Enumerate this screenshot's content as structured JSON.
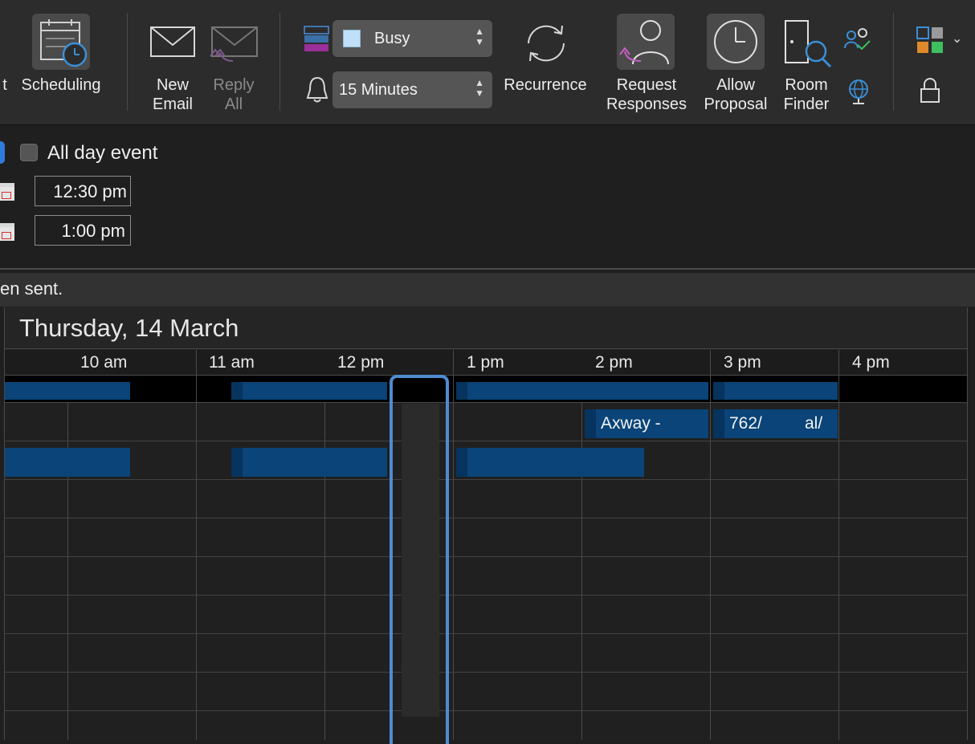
{
  "ribbon": {
    "scheduling_label": "Scheduling",
    "scheduling_prefix": "t",
    "new_email_label_1": "New",
    "new_email_label_2": "Email",
    "reply_all_label_1": "Reply",
    "reply_all_label_2": "All",
    "show_as_value": "Busy",
    "reminder_value": "15 Minutes",
    "recurrence_label": "Recurrence",
    "request_responses_label_1": "Request",
    "request_responses_label_2": "Responses",
    "allow_proposal_label_1": "Allow",
    "allow_proposal_label_2": "Proposal",
    "room_finder_label_1": "Room",
    "room_finder_label_2": "Finder"
  },
  "form": {
    "all_day_label": "All day event",
    "start_time": "12:30 pm",
    "end_time": "1:00 pm"
  },
  "infobar": {
    "text": "en sent."
  },
  "schedule": {
    "date": "Thursday, 14 March",
    "hours": [
      "10 am",
      "11 am",
      "12 pm",
      "1 pm",
      "2 pm",
      "3 pm",
      "4 pm"
    ],
    "events": [
      "Axway -",
      "762/",
      "al/"
    ]
  },
  "colors": {
    "busy_block": "#0a4478",
    "selection_border": "#4f8bd0",
    "background": "#1f1f1f"
  }
}
